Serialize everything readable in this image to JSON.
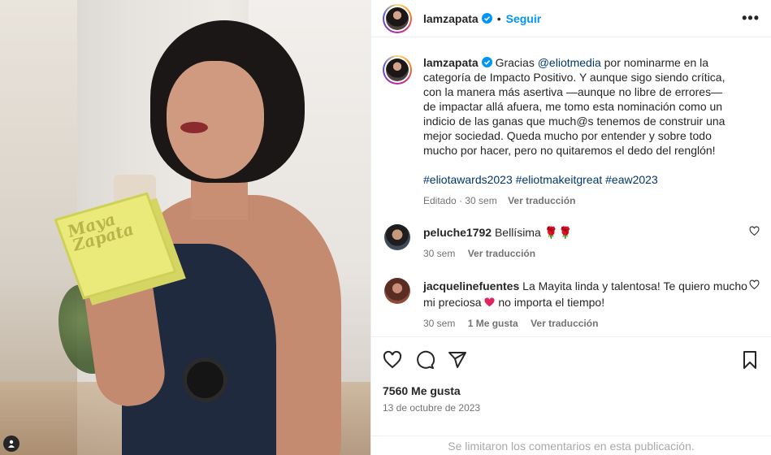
{
  "photo": {
    "box_text_line1": "Maya",
    "box_text_line2": "Zapata"
  },
  "header": {
    "username": "lamzapata",
    "separator": "•",
    "follow_label": "Seguir",
    "more_label": "•••"
  },
  "caption": {
    "username": "lamzapata",
    "text_before_mention": "Gracias ",
    "mention": "@eliotmedia",
    "text_after_mention": " por nominarme en la categoría de Impacto Positivo. Y aunque sigo siendo crítica, con la manera más asertiva —aunque no libre de errores— de impactar allá afuera, me tomo esta nominación como un indicio de las ganas que much@s tenemos de construir una mejor sociedad. Queda mucho por entender y sobre todo mucho por hacer, pero no quitaremos el dedo del renglón!",
    "hashtags": "#eliotawards2023 #eliotmakeitgreat #eaw2023",
    "meta_time": "Editado · 30 sem",
    "meta_translate": "Ver traducción"
  },
  "comments": [
    {
      "username": "peluche1792",
      "text": "Bellísima 🌹🌹",
      "time": "30 sem",
      "likes": "",
      "translate": "Ver traducción"
    },
    {
      "username": "jacquelinefuentes",
      "text_before_heart": "La Mayita linda y talentosa! Te quiero mucho mi preciosa ",
      "text_after_heart": " no importa el tiempo!",
      "time": "30 sem",
      "likes": "1 Me gusta",
      "translate": "Ver traducción"
    }
  ],
  "likes_count": "7560 Me gusta",
  "post_date": "13 de octubre de 2023",
  "footer_text": "Se limitaron los comentarios en esta publicación.",
  "colors": {
    "link": "#0095f6",
    "hashtag": "#00376b",
    "muted": "#737373"
  }
}
